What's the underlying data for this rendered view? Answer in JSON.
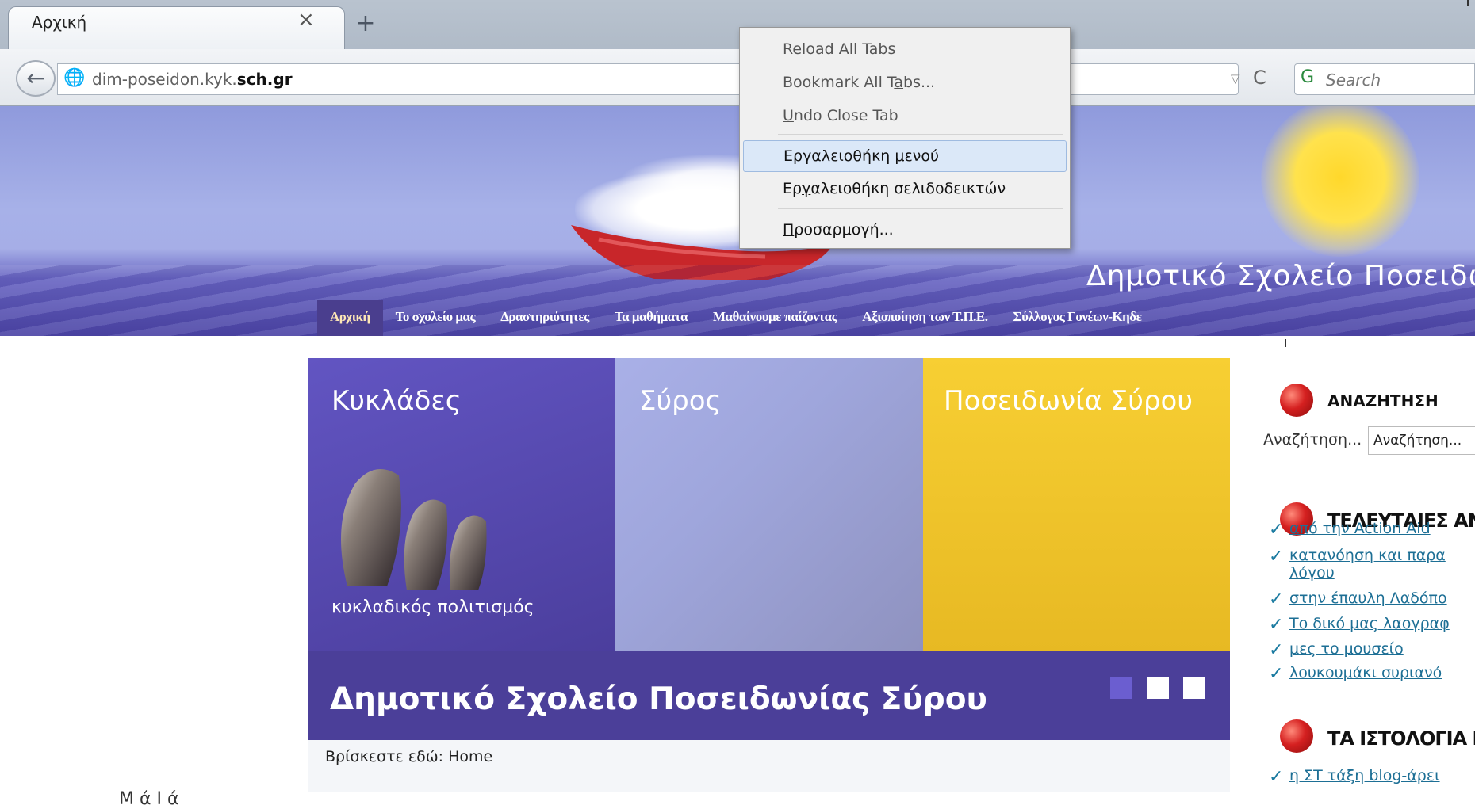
{
  "browser": {
    "tab_title": "Αρχική",
    "tab_close": "×",
    "new_tab": "+",
    "url_prefix": "dim-poseidon.kyk.",
    "url_domain": "sch.gr",
    "search_placeholder": "Search",
    "back_glyph": "←",
    "reload_glyph": "C",
    "dropmark": "▽"
  },
  "context_menu": {
    "items": [
      "Reload All Tabs",
      "Bookmark All Tabs...",
      "Undo Close Tab",
      "Εργαλειοθήκη μενού",
      "Εργαλειοθήκη σελιδοδεικτών",
      "Προσαρμογή..."
    ],
    "highlighted_index": 3
  },
  "site": {
    "title": "Δημοτικό Σχολείο Ποσειδωνί",
    "nav": [
      "Αρχική",
      "Το σχολείο μας",
      "Δραστηριότητες",
      "Τα μαθήματα",
      "Μαθαίνουμε παίζοντας",
      "Αξιοποίηση των Τ.Π.Ε.",
      "Σύλλογος Γονέων-Κηδε"
    ],
    "nav_active_index": 0
  },
  "slideshow": {
    "panels": [
      "Κυκλάδες",
      "Σύρος",
      "Ποσειδωνία Σύρου"
    ],
    "panel1_caption": "κυκλαδικός πολιτισμός",
    "caption": "Δημοτικό Σχολείο Ποσειδωνίας Σύρου",
    "active_dot": 0
  },
  "breadcrumb": "Βρίσκεστε εδώ: Home",
  "bottom_cut_text": "Μ    ά    Ι        ά",
  "sidebar": {
    "search_heading": "ΑΝΑΖΗΤΗΣΗ",
    "search_label": "Αναζήτηση...",
    "search_value": "Αναζήτηση...",
    "latest_heading": "ΤΕΛΕΥΤΑΙΕΣ ΑΝΑ",
    "latest_links": [
      "από την Action Aid",
      "κατανόηση και παρα",
      "λόγου",
      "στην έπαυλη Λαδόπο",
      "Το δικό μας λαογραφ",
      "μες το μουσείο",
      "λουκουμάκι συριανό"
    ],
    "blogs_heading": "ΤΑ ΙΣΤΟΛΟΓΙΑ ΜΑ",
    "blog_links": [
      "η ΣΤ τάξη blog-άρει"
    ]
  },
  "colors": {
    "menu_highlight": "#dbe8f8",
    "nav_active": "#4a3e8e",
    "panel_purple": "#5a4db5",
    "panel_yellow": "#f2c62d",
    "link": "#1d6f95"
  }
}
